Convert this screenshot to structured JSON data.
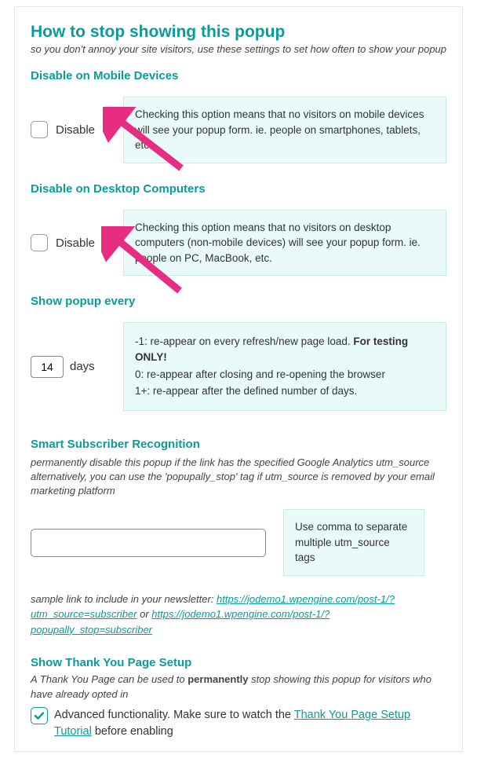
{
  "main": {
    "title": "How to stop showing this popup",
    "subtitle": "so you don't annoy your site visitors, use these settings to set how often to show your popup"
  },
  "mobile": {
    "heading": "Disable on Mobile Devices",
    "label": "Disable",
    "help": "Checking this option means that no visitors on mobile devices will see your popup form. ie. people on smartphones, tablets, etc."
  },
  "desktop": {
    "heading": "Disable on Desktop Computers",
    "label": "Disable",
    "help": "Checking this option means that no visitors on desktop computers (non-mobile devices) will see your popup form. ie. people on PC, MacBook, etc."
  },
  "freq": {
    "heading": "Show popup every",
    "value": "14",
    "unit": "days",
    "help_l1_a": "-1: re-appear on every refresh/new page load. ",
    "help_l1_b": "For testing ONLY!",
    "help_l2": "0: re-appear after closing and re-opening the browser",
    "help_l3": "1+: re-appear after the defined number of days."
  },
  "smart": {
    "heading": "Smart Subscriber Recognition",
    "desc": "permanently disable this popup if the link has the specified Google Analytics utm_source alternatively, you can use the 'popupally_stop' tag if utm_source is removed by your email marketing platform",
    "help": "Use comma to separate multiple utm_source tags",
    "sample_pre": "sample link to include in your newsletter: ",
    "sample_link1": "https://jodemo1.wpengine.com/post-1/?utm_source=subscriber",
    "sample_or": " or ",
    "sample_link2": "https://jodemo1.wpengine.com/post-1/?popupally_stop=subscriber"
  },
  "thank": {
    "heading": "Show Thank You Page Setup",
    "desc_a": "A Thank You Page can be used to ",
    "desc_b": "permanently",
    "desc_c": " stop showing this popup for visitors who have already opted in",
    "adv_pre": "Advanced functionality. Make sure to watch the ",
    "adv_link": "Thank You Page Setup Tutorial",
    "adv_post": " before enabling"
  },
  "colors": {
    "arrow": "#E62D82"
  }
}
